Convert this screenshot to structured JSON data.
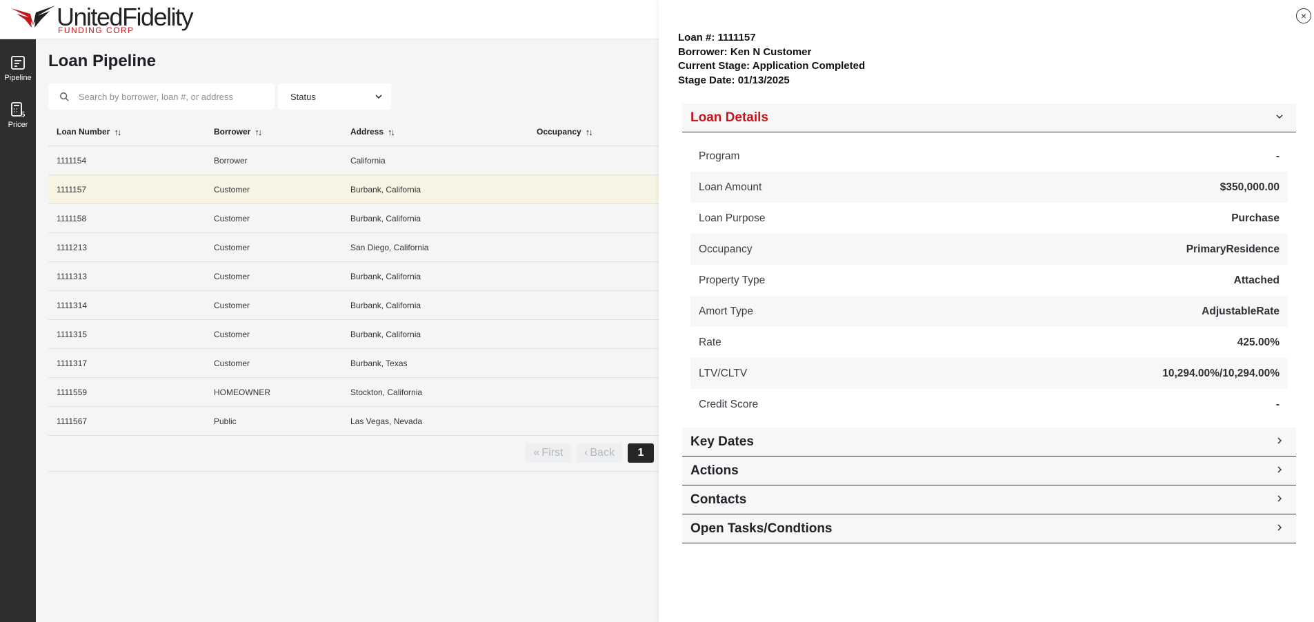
{
  "brand": {
    "name": "UnitedFidelity",
    "sub": "FUNDING CORP",
    "accent": "#c4161c"
  },
  "sidebar": {
    "items": [
      {
        "label": "Pipeline",
        "icon": "pipeline-icon"
      },
      {
        "label": "Pricer",
        "icon": "calculator-icon"
      }
    ]
  },
  "main": {
    "title": "Loan Pipeline",
    "search": {
      "placeholder": "Search by borrower, loan #, or address",
      "value": ""
    },
    "status_filter": {
      "label": "Status"
    },
    "table": {
      "columns": [
        "Loan Number",
        "Borrower",
        "Address",
        "Occupancy"
      ],
      "rows": [
        {
          "loan": "1111154",
          "borrower": "Borrower",
          "address": "California",
          "occupancy": ""
        },
        {
          "loan": "1111157",
          "borrower": "Customer",
          "address": "Burbank, California",
          "occupancy": ""
        },
        {
          "loan": "1111158",
          "borrower": "Customer",
          "address": "Burbank, California",
          "occupancy": ""
        },
        {
          "loan": "1111213",
          "borrower": "Customer",
          "address": "San Diego, California",
          "occupancy": ""
        },
        {
          "loan": "1111313",
          "borrower": "Customer",
          "address": "Burbank, California",
          "occupancy": ""
        },
        {
          "loan": "1111314",
          "borrower": "Customer",
          "address": "Burbank, California",
          "occupancy": ""
        },
        {
          "loan": "1111315",
          "borrower": "Customer",
          "address": "Burbank, California",
          "occupancy": ""
        },
        {
          "loan": "1111317",
          "borrower": "Customer",
          "address": "Burbank, Texas",
          "occupancy": ""
        },
        {
          "loan": "1111559",
          "borrower": "HOMEOWNER",
          "address": "Stockton, California",
          "occupancy": ""
        },
        {
          "loan": "1111567",
          "borrower": "Public",
          "address": "Las Vegas, Nevada",
          "occupancy": ""
        }
      ]
    },
    "pager": {
      "first": "First",
      "back": "Back",
      "page": "1"
    }
  },
  "panel": {
    "header": {
      "loan": "Loan #: 1111157",
      "borrower": "Borrower: Ken N Customer",
      "stage": "Current Stage: Application Completed",
      "stage_date": "Stage Date: 01/13/2025"
    },
    "loan_details": {
      "title": "Loan Details",
      "rows": [
        {
          "label": "Program",
          "value": "-"
        },
        {
          "label": "Loan Amount",
          "value": "$350,000.00"
        },
        {
          "label": "Loan Purpose",
          "value": "Purchase"
        },
        {
          "label": "Occupancy",
          "value": "PrimaryResidence"
        },
        {
          "label": "Property Type",
          "value": "Attached"
        },
        {
          "label": "Amort Type",
          "value": "AdjustableRate"
        },
        {
          "label": "Rate",
          "value": "425.00%"
        },
        {
          "label": "LTV/CLTV",
          "value": "10,294.00%/10,294.00%"
        },
        {
          "label": "Credit Score",
          "value": "-"
        }
      ]
    },
    "sections": [
      "Key Dates",
      "Actions",
      "Contacts",
      "Open Tasks/Condtions"
    ]
  }
}
